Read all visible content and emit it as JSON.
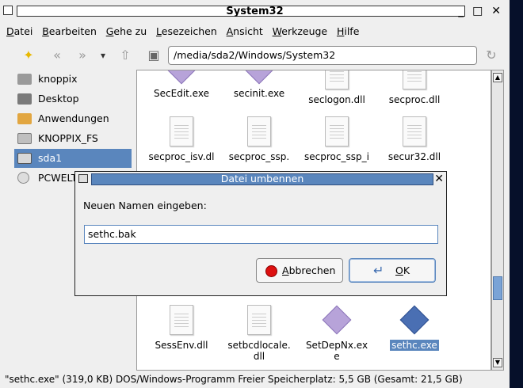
{
  "window": {
    "title": "System32",
    "controls": "_ □ ✕"
  },
  "menu": [
    {
      "first": "D",
      "rest": "atei"
    },
    {
      "first": "B",
      "rest": "earbeiten"
    },
    {
      "first": "G",
      "rest": "ehe zu"
    },
    {
      "first": "L",
      "rest": "esezeichen"
    },
    {
      "first": "A",
      "rest": "nsicht"
    },
    {
      "first": "W",
      "rest": "erkzeuge"
    },
    {
      "first": "H",
      "rest": "ilfe"
    }
  ],
  "toolbar": {
    "location": "/media/sda2/Windows/System32"
  },
  "sidebar": {
    "items": [
      {
        "label": "knoppix",
        "icon": "home-icon"
      },
      {
        "label": "Desktop",
        "icon": "desktop-icon"
      },
      {
        "label": "Anwendungen",
        "icon": "applications-icon"
      },
      {
        "label": "KNOPPIX_FS",
        "icon": "drive-icon"
      },
      {
        "label": "sda1",
        "icon": "drive-icon"
      },
      {
        "label": "PCWELT",
        "icon": "cdrom-icon"
      }
    ]
  },
  "files": {
    "row1": [
      "SecEdit.exe",
      "secinit.exe",
      "seclogon.dll",
      "secproc.dll"
    ],
    "row2": [
      "secproc_isv.dl",
      "secproc_ssp.",
      "secproc_ssp_i",
      "secur32.dll"
    ],
    "row3": [
      "SessEnv.dll",
      "setbcdlocale.",
      "SetDepNx.ex",
      "sethc.exe"
    ],
    "row3_line2": [
      "",
      "dll",
      "e",
      ""
    ]
  },
  "dialog": {
    "title": "Datei umbennen",
    "prompt": "Neuen Namen eingeben:",
    "input_value": "sethc.bak",
    "cancel_first": "A",
    "cancel_rest": "bbrechen",
    "ok_first": "O",
    "ok_rest": "K"
  },
  "status": "\"sethc.exe\" (319,0 KB) DOS/Windows-Programm  Freier Speicherplatz: 5,5 GB (Gesamt: 21,5 GB)",
  "colors": {
    "selection": "#5a86bd",
    "window_bg": "#efefef"
  }
}
